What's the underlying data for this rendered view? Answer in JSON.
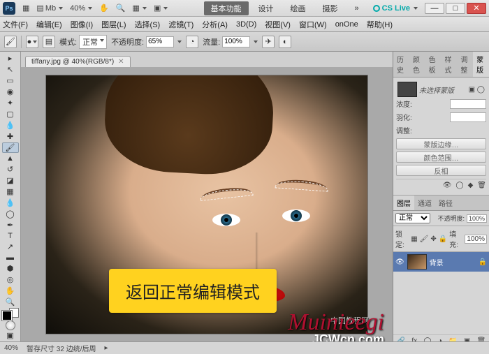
{
  "app": {
    "logo": "Ps"
  },
  "titlebar": {
    "tools_label": "Mb",
    "zoom": "40%",
    "modes": [
      "基本功能",
      "设计",
      "绘画",
      "摄影"
    ],
    "cslive": "CS Live"
  },
  "menu": {
    "items": [
      "文件(F)",
      "编辑(E)",
      "图像(I)",
      "图层(L)",
      "选择(S)",
      "滤镜(T)",
      "分析(A)",
      "3D(D)",
      "视图(V)",
      "窗口(W)",
      "onOne",
      "帮助(H)"
    ]
  },
  "options": {
    "mode_label": "模式:",
    "mode_value": "正常",
    "opacity_label": "不透明度:",
    "opacity_value": "65%",
    "flow_label": "流量:",
    "flow_value": "100%"
  },
  "document": {
    "tab_label": "tiffany.jpg @ 40%(RGB/8*)"
  },
  "tooltip": {
    "text": "返回正常编辑模式"
  },
  "panels": {
    "history_tabs": [
      "历史",
      "颜色",
      "色板",
      "样式",
      "调整",
      "蒙版"
    ],
    "mask_status": "未选择蒙版",
    "mask_labels": {
      "density": "浓度:",
      "feather": "羽化:",
      "refine": "调整:"
    },
    "mask_buttons": [
      "蒙版边缘…",
      "颜色范围…",
      "反相"
    ],
    "layer_tabs": [
      "图层",
      "通道",
      "路径"
    ],
    "blend": "正常",
    "opacity_lbl": "不透明度:",
    "opacity_val": "100%",
    "lock_lbl": "锁定:",
    "fill_lbl": "填充:",
    "fill_val": "100%",
    "bg_layer": "背景"
  },
  "status": {
    "zoom": "40%",
    "info": "暂存尺寸 32 边统/后周"
  },
  "watermark": {
    "sig": "Muinieegi",
    "cn": "中国教程网",
    "site": "JCWcn.com"
  }
}
